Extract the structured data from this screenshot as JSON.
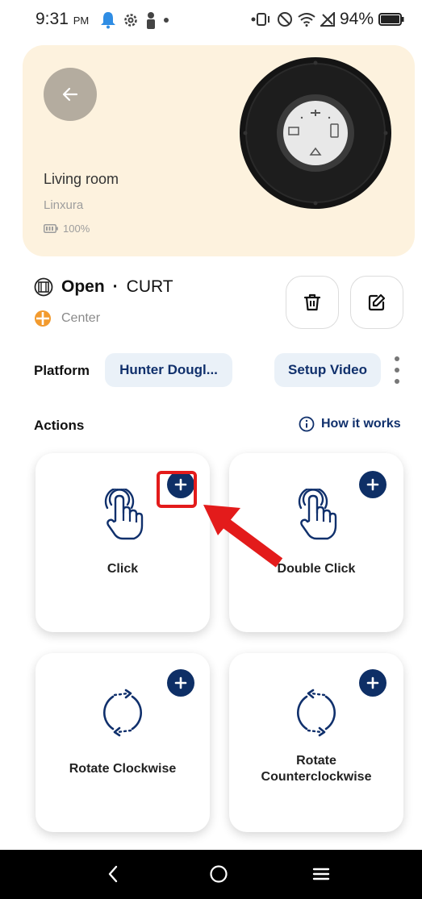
{
  "status_bar": {
    "time": "9:31",
    "ampm": "PM",
    "battery_percent": "94%"
  },
  "hero": {
    "room": "Living room",
    "brand": "Linxura",
    "battery": "100%",
    "bg_color": "#fdf2de"
  },
  "device": {
    "state": "Open",
    "separator": "·",
    "type": "CURT",
    "position": "Center",
    "delete_icon": "trash-icon",
    "edit_icon": "edit-icon"
  },
  "platform": {
    "label": "Platform",
    "value": "Hunter Dougl...",
    "setup_video": "Setup Video"
  },
  "actions": {
    "title": "Actions",
    "how_it_works": "How it works",
    "items": [
      {
        "label": "Click",
        "icon": "tap-hand-icon"
      },
      {
        "label": "Double Click",
        "icon": "tap-hand-icon"
      },
      {
        "label": "Rotate Clockwise",
        "icon": "rotate-clockwise-icon"
      },
      {
        "label": "Rotate Counterclockwise",
        "icon": "rotate-counterclockwise-icon"
      }
    ]
  },
  "colors": {
    "accent_navy": "#0e2f66",
    "chip_bg": "#eaf1f8",
    "highlight_red": "#e31b1b"
  }
}
